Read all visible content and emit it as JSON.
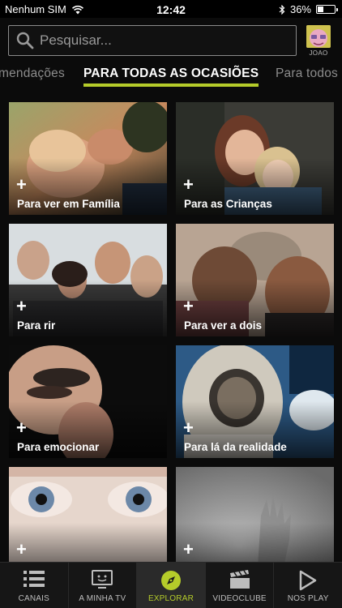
{
  "status_bar": {
    "carrier": "Nenhum SIM",
    "time": "12:42",
    "battery": "36%",
    "battery_level": 0.36
  },
  "search": {
    "placeholder": "Pesquisar..."
  },
  "profile": {
    "name": "JOAO"
  },
  "tabs": [
    {
      "label": "mendações"
    },
    {
      "label": "PARA TODAS AS OCASIÕES",
      "active": true
    },
    {
      "label": "Para todos"
    }
  ],
  "cards": [
    {
      "label": "Para ver em Família",
      "icon": "plus-icon"
    },
    {
      "label": "Para as Crianças",
      "icon": "plus-icon"
    },
    {
      "label": "Para rir",
      "icon": "plus-icon"
    },
    {
      "label": "Para ver a dois",
      "icon": "plus-icon"
    },
    {
      "label": "Para emocionar",
      "icon": "plus-icon"
    },
    {
      "label": "Para lá da realidade",
      "icon": "plus-icon"
    },
    {
      "label": "",
      "icon": "plus-icon"
    },
    {
      "label": "",
      "icon": "plus-icon"
    }
  ],
  "plus_symbol": "+",
  "bottom_nav": [
    {
      "label": "CANAIS",
      "icon": "list-icon"
    },
    {
      "label": "A MINHA TV",
      "icon": "tv-icon"
    },
    {
      "label": "EXPLORAR",
      "icon": "compass-icon",
      "active": true
    },
    {
      "label": "VIDEOCLUBE",
      "icon": "clapperboard-icon"
    },
    {
      "label": "NOS PLAY",
      "icon": "play-icon"
    }
  ],
  "colors": {
    "accent": "#b5cc2a",
    "background": "#0b0b0b"
  }
}
